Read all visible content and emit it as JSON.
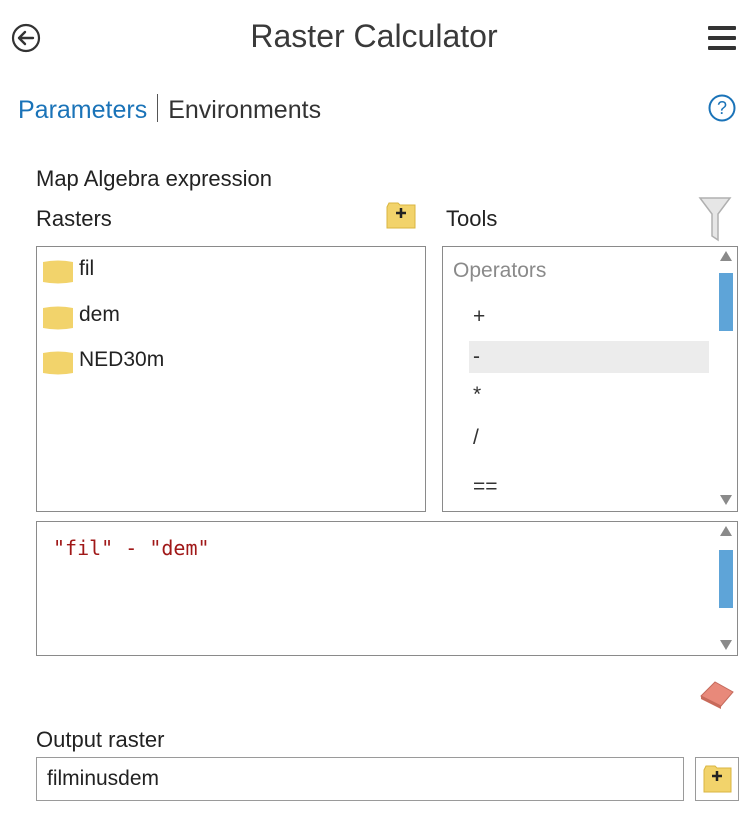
{
  "header": {
    "title": "Raster Calculator",
    "back_icon": "back-arrow-circle-icon",
    "menu_icon": "hamburger-menu-icon"
  },
  "tabs": {
    "parameters": "Parameters",
    "environments": "Environments",
    "help_icon": "help-icon"
  },
  "map_algebra": {
    "label": "Map Algebra expression",
    "rasters_label": "Rasters",
    "tools_label": "Tools",
    "rasters": [
      "fil",
      "dem",
      "NED30m"
    ],
    "operators_header": "Operators",
    "operators": [
      "+",
      "-",
      "*",
      "/",
      "=="
    ],
    "selected_operator": "-",
    "expression": "\"fil\" - \"dem\""
  },
  "output": {
    "label": "Output raster",
    "value": "filminusdem"
  },
  "colors": {
    "accent": "#1a73b8",
    "folder": "#f2d36b",
    "expression_text": "#a01818",
    "scroll_thumb": "#5ea4d8"
  }
}
